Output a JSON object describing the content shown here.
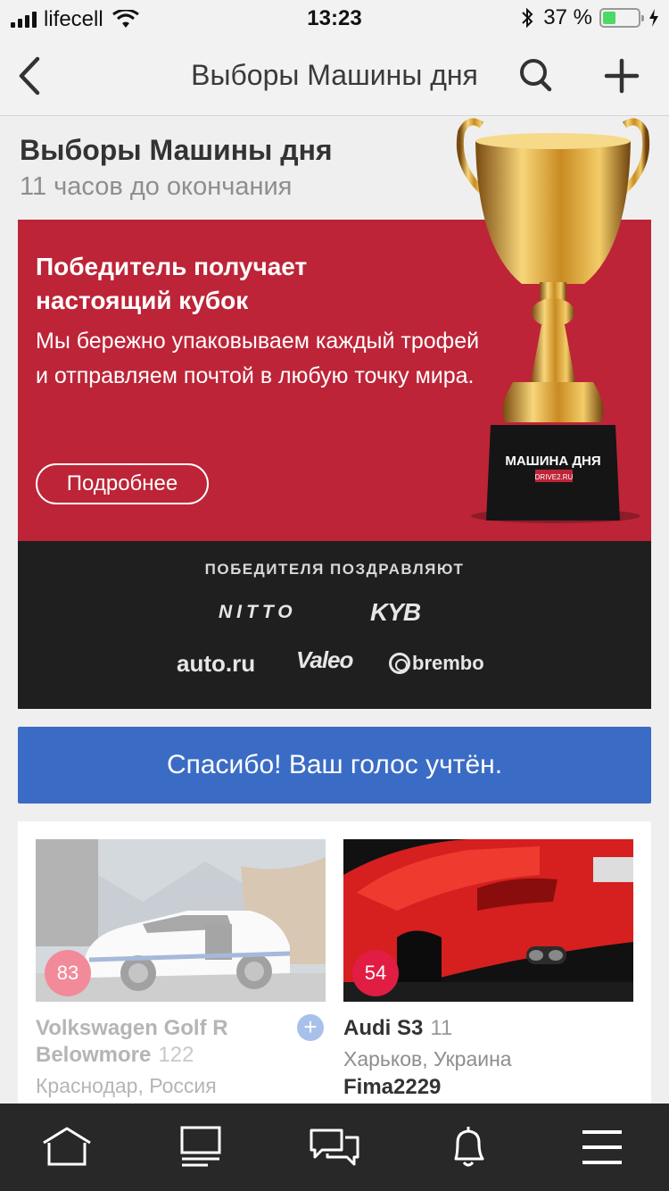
{
  "status_bar": {
    "carrier": "lifecell",
    "time": "13:23",
    "battery_text": "37 %",
    "battery_level": 0.37
  },
  "nav": {
    "title": "Выборы Машины дня",
    "back_icon": "chevron-left-icon",
    "search_icon": "search-icon",
    "add_icon": "plus-icon"
  },
  "header": {
    "title": "Выборы Машины дня",
    "subtitle": "11 часов до окончания"
  },
  "promo": {
    "title": "Победитель получает настоящий кубок",
    "text": "Мы бережно упаковываем каждый трофей и отправляем почтой в любую точку мира.",
    "button_label": "Подробнее",
    "trophy_plate": "МАШИНА ДНЯ",
    "trophy_brand": "DRIVE2.RU",
    "background_color": "#bd2437"
  },
  "sponsors": {
    "title": "ПОБЕДИТЕЛЯ ПОЗДРАВЛЯЮТ",
    "logos": [
      "NITTO",
      "KYB",
      "auto.ru",
      "Valeo",
      "brembo"
    ]
  },
  "vote_banner": {
    "text": "Спасибо! Ваш голос учтён.",
    "color": "#3a6cc5"
  },
  "cars": [
    {
      "votes": "83",
      "name": "Volkswagen Golf R Belowmore",
      "count": "122",
      "location": "Краснодар, Россия"
    },
    {
      "votes": "54",
      "name": "Audi S3",
      "count": "11",
      "location": "Харьков, Украина",
      "user": "Fima2229"
    }
  ],
  "tabbar": {
    "items": [
      "home-icon",
      "feed-icon",
      "messages-icon",
      "notifications-icon",
      "menu-icon"
    ]
  }
}
